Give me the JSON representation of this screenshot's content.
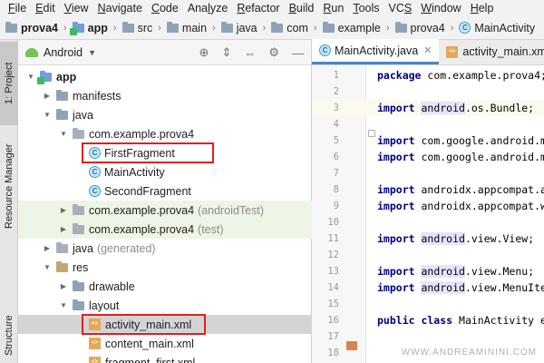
{
  "menubar": {
    "items": [
      "File",
      "Edit",
      "View",
      "Navigate",
      "Code",
      "Analyze",
      "Refactor",
      "Build",
      "Run",
      "Tools",
      "VCS",
      "Window",
      "Help"
    ],
    "underline_index": [
      0,
      0,
      0,
      0,
      0,
      3,
      0,
      0,
      0,
      0,
      2,
      0,
      0
    ]
  },
  "breadcrumb": {
    "items": [
      {
        "label": "prova4",
        "bold": true,
        "icon": "project-folder-icon"
      },
      {
        "label": "app",
        "bold": true,
        "icon": "module-folder-icon"
      },
      {
        "label": "src",
        "bold": false,
        "icon": "folder-icon"
      },
      {
        "label": "main",
        "bold": false,
        "icon": "folder-icon"
      },
      {
        "label": "java",
        "bold": false,
        "icon": "folder-icon"
      },
      {
        "label": "com",
        "bold": false,
        "icon": "folder-icon"
      },
      {
        "label": "example",
        "bold": false,
        "icon": "folder-icon"
      },
      {
        "label": "prova4",
        "bold": false,
        "icon": "folder-icon"
      },
      {
        "label": "MainActivity",
        "bold": false,
        "icon": "class-icon"
      }
    ]
  },
  "side_tabs": {
    "project": "1: Project",
    "resource_manager": "Resource Manager",
    "structure": "Structure"
  },
  "project_panel": {
    "view_mode": "Android",
    "tree": [
      {
        "label": "app",
        "suffix": "",
        "level": 0,
        "arrow": "open",
        "icon": "module-folder-icon",
        "bold": true,
        "bg": ""
      },
      {
        "label": "manifests",
        "suffix": "",
        "level": 1,
        "arrow": "closed",
        "icon": "folder-icon",
        "bold": false,
        "bg": ""
      },
      {
        "label": "java",
        "suffix": "",
        "level": 1,
        "arrow": "open",
        "icon": "folder-icon",
        "bold": false,
        "bg": ""
      },
      {
        "label": "com.example.prova4",
        "suffix": "",
        "level": 2,
        "arrow": "open",
        "icon": "package-icon",
        "bold": false,
        "bg": ""
      },
      {
        "label": "FirstFragment",
        "suffix": "",
        "level": 3,
        "arrow": "",
        "icon": "class-icon",
        "bold": false,
        "bg": "",
        "boxed": true
      },
      {
        "label": "MainActivity",
        "suffix": "",
        "level": 3,
        "arrow": "",
        "icon": "class-icon",
        "bold": false,
        "bg": ""
      },
      {
        "label": "SecondFragment",
        "suffix": "",
        "level": 3,
        "arrow": "",
        "icon": "class-icon",
        "bold": false,
        "bg": ""
      },
      {
        "label": "com.example.prova4",
        "suffix": "(androidTest)",
        "level": 2,
        "arrow": "closed",
        "icon": "package-icon",
        "bold": false,
        "bg": "green"
      },
      {
        "label": "com.example.prova4",
        "suffix": "(test)",
        "level": 2,
        "arrow": "closed",
        "icon": "package-icon",
        "bold": false,
        "bg": "green"
      },
      {
        "label": "java",
        "suffix": "(generated)",
        "level": 1,
        "arrow": "closed",
        "icon": "generated-folder-icon",
        "bold": false,
        "bg": ""
      },
      {
        "label": "res",
        "suffix": "",
        "level": 1,
        "arrow": "open",
        "icon": "res-folder-icon",
        "bold": false,
        "bg": ""
      },
      {
        "label": "drawable",
        "suffix": "",
        "level": 2,
        "arrow": "closed",
        "icon": "folder-icon",
        "bold": false,
        "bg": ""
      },
      {
        "label": "layout",
        "suffix": "",
        "level": 2,
        "arrow": "open",
        "icon": "folder-icon",
        "bold": false,
        "bg": ""
      },
      {
        "label": "activity_main.xml",
        "suffix": "",
        "level": 3,
        "arrow": "",
        "icon": "xml-file-icon",
        "bold": false,
        "bg": "selected",
        "boxed": true
      },
      {
        "label": "content_main.xml",
        "suffix": "",
        "level": 3,
        "arrow": "",
        "icon": "xml-file-icon",
        "bold": false,
        "bg": ""
      },
      {
        "label": "fragment_first.xml",
        "suffix": "",
        "level": 3,
        "arrow": "",
        "icon": "xml-file-icon",
        "bold": false,
        "bg": ""
      }
    ]
  },
  "editor": {
    "tabs": [
      {
        "label": "MainActivity.java",
        "active": true,
        "icon": "class-icon"
      },
      {
        "label": "activity_main.xml",
        "active": false,
        "icon": "xml-file-icon"
      }
    ],
    "lines": [
      {
        "n": "1",
        "parts": [
          {
            "t": "package ",
            "c": "kw"
          },
          {
            "t": "com.example.prova4;",
            "c": ""
          }
        ]
      },
      {
        "n": "2",
        "parts": []
      },
      {
        "n": "3",
        "parts": [
          {
            "t": "import ",
            "c": "kw"
          },
          {
            "t": "android",
            "c": "pk"
          },
          {
            "t": ".os.Bundle;",
            "c": ""
          }
        ],
        "hl": true
      },
      {
        "n": "4",
        "parts": []
      },
      {
        "n": "5",
        "parts": [
          {
            "t": "import ",
            "c": "kw"
          },
          {
            "t": "com.google.android.m",
            "c": ""
          }
        ]
      },
      {
        "n": "6",
        "parts": [
          {
            "t": "import ",
            "c": "kw"
          },
          {
            "t": "com.google.android.m",
            "c": ""
          }
        ]
      },
      {
        "n": "7",
        "parts": []
      },
      {
        "n": "8",
        "parts": [
          {
            "t": "import ",
            "c": "kw"
          },
          {
            "t": "androidx.appcompat.a",
            "c": ""
          }
        ]
      },
      {
        "n": "9",
        "parts": [
          {
            "t": "import ",
            "c": "kw"
          },
          {
            "t": "androidx.appcompat.w",
            "c": ""
          }
        ]
      },
      {
        "n": "10",
        "parts": []
      },
      {
        "n": "11",
        "parts": [
          {
            "t": "import ",
            "c": "kw"
          },
          {
            "t": "android",
            "c": "pk"
          },
          {
            "t": ".view.View;",
            "c": ""
          }
        ]
      },
      {
        "n": "12",
        "parts": []
      },
      {
        "n": "13",
        "parts": [
          {
            "t": "import ",
            "c": "kw"
          },
          {
            "t": "android",
            "c": "pk"
          },
          {
            "t": ".view.Menu;",
            "c": ""
          }
        ]
      },
      {
        "n": "14",
        "parts": [
          {
            "t": "import ",
            "c": "kw"
          },
          {
            "t": "android",
            "c": "pk"
          },
          {
            "t": ".view.MenuIte",
            "c": ""
          }
        ]
      },
      {
        "n": "15",
        "parts": []
      },
      {
        "n": "16",
        "parts": [
          {
            "t": "public class ",
            "c": "kw"
          },
          {
            "t": "MainActivity e",
            "c": ""
          }
        ],
        "run": true
      },
      {
        "n": "17",
        "parts": []
      },
      {
        "n": "18",
        "parts": []
      }
    ],
    "watermark": "WWW.ANDREAMININI.COM"
  }
}
